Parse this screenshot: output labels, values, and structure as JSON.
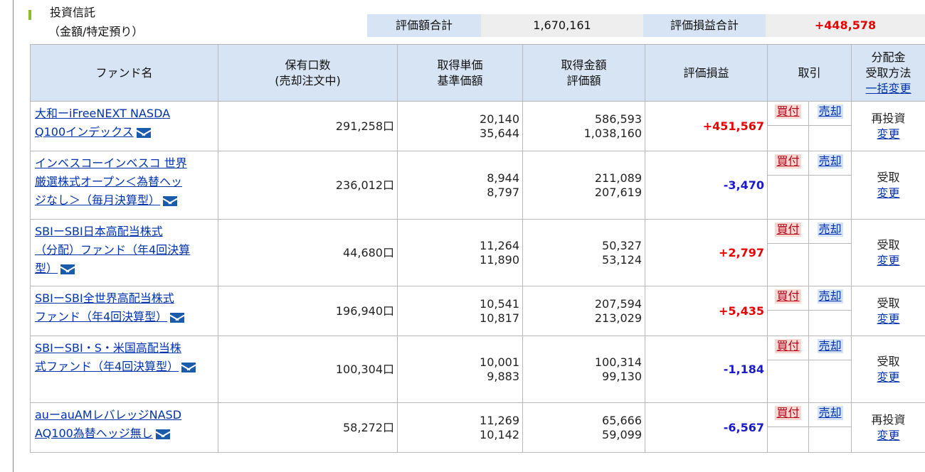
{
  "section": {
    "title": "投資信託",
    "subtitle": "（金額/特定預り）"
  },
  "summary": {
    "valuation_label": "評価額合計",
    "valuation_value": "1,670,161",
    "pl_label": "評価損益合計",
    "pl_value": "+448,578"
  },
  "table": {
    "headers": {
      "fund": "ファンド名",
      "units_1": "保有口数",
      "units_2": "(売却注文中)",
      "price_1": "取得単価",
      "price_2": "基準価額",
      "amount_1": "取得金額",
      "amount_2": "評価額",
      "pl": "評価損益",
      "trade": "取引",
      "dist_1": "分配金",
      "dist_2": "受取方法",
      "dist_link": "一括変更"
    },
    "buy_label": "買付",
    "sell_label": "売却",
    "change_label": "変更",
    "rows": [
      {
        "name_lines": [
          "大和ーiFreeNEXT NASDA",
          "Q100インデックス"
        ],
        "units": "291,258口",
        "acq_price": "20,140",
        "nav": "35,644",
        "acq_amount": "586,593",
        "valuation": "1,038,160",
        "pl": "+451,567",
        "pl_sign": "pos",
        "dist": "再投資"
      },
      {
        "name_lines": [
          "インベスコーインベスコ 世界",
          "厳選株式オープン＜為替ヘッ",
          "ジなし＞（毎月決算型）"
        ],
        "units": "236,012口",
        "acq_price": "8,944",
        "nav": "8,797",
        "acq_amount": "211,089",
        "valuation": "207,619",
        "pl": "-3,470",
        "pl_sign": "neg",
        "dist": "受取"
      },
      {
        "name_lines": [
          "SBIーSBI日本高配当株式",
          "（分配）ファンド（年4回決算",
          "型）"
        ],
        "units": "44,680口",
        "acq_price": "11,264",
        "nav": "11,890",
        "acq_amount": "50,327",
        "valuation": "53,124",
        "pl": "+2,797",
        "pl_sign": "pos",
        "dist": "受取"
      },
      {
        "name_lines": [
          "SBIーSBI全世界高配当株式",
          "ファンド（年4回決算型）"
        ],
        "units": "196,940口",
        "acq_price": "10,541",
        "nav": "10,817",
        "acq_amount": "207,594",
        "valuation": "213,029",
        "pl": "+5,435",
        "pl_sign": "pos",
        "dist": "受取"
      },
      {
        "name_lines": [
          "SBIーSBI・S・米国高配当株",
          "式ファンド（年4回決算型）"
        ],
        "units": "100,304口",
        "acq_price": "10,001",
        "nav": "9,883",
        "acq_amount": "100,314",
        "valuation": "99,130",
        "pl": "-1,184",
        "pl_sign": "neg",
        "dist": "受取"
      },
      {
        "name_lines": [
          "auーauAMレバレッジNASD",
          "AQ100為替ヘッジ無し"
        ],
        "units": "58,272口",
        "acq_price": "11,269",
        "nav": "10,142",
        "acq_amount": "65,666",
        "valuation": "59,099",
        "pl": "-6,567",
        "pl_sign": "neg",
        "dist": "再投資"
      }
    ]
  },
  "colors": {
    "header_bg": "#d6e4f3",
    "positive": "#e60000",
    "negative": "#1a1acc",
    "link": "#0033aa",
    "accent": "#8cbf26"
  }
}
